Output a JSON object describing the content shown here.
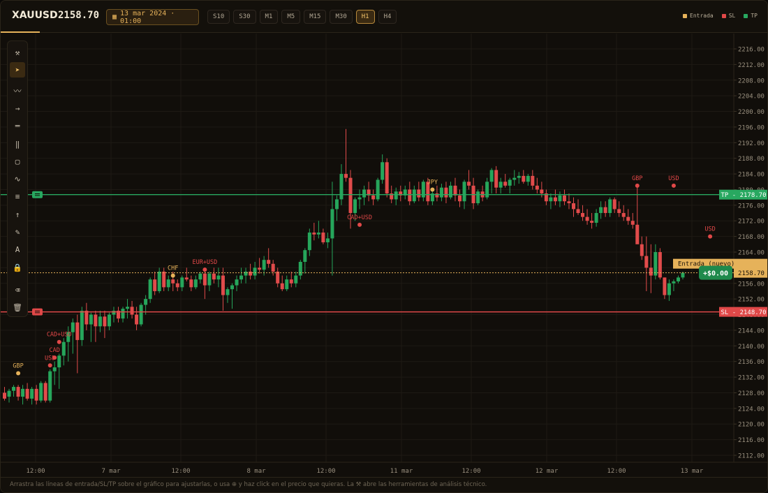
{
  "header": {
    "symbol": "XAUUSD",
    "price": "2158.70",
    "date": "13 mar 2024 · 01:00",
    "timeframes": [
      "S10",
      "S30",
      "M1",
      "M5",
      "M15",
      "M30",
      "H1",
      "H4"
    ],
    "active_timeframe": "H1",
    "legend": [
      {
        "label": "Entrada",
        "color": "#e6b25a"
      },
      {
        "label": "SL",
        "color": "#e04848"
      },
      {
        "label": "TP",
        "color": "#28a860"
      }
    ]
  },
  "toolbar": {
    "icons": [
      "crossed-tools-icon",
      "cursor-icon",
      "trend-line-icon",
      "ray-arrow-icon",
      "horizontal-lines-icon",
      "vertical-lines-icon",
      "rectangle-icon",
      "wave-icon",
      "fib-lines-icon",
      "up-arrow-icon",
      "pencil-icon",
      "text-icon",
      "magnet-lock-icon",
      "eraser-icon",
      "trash-icon"
    ],
    "glyphs": [
      "⚒",
      "➤",
      "〰",
      "→",
      "═",
      "‖",
      "▢",
      "∿",
      "≡",
      "↑",
      "✎",
      "A",
      "🔒",
      "⌫",
      "🗑"
    ],
    "active_index": 1
  },
  "chart_data": {
    "type": "candlestick",
    "y_axis_ticks": [
      "2216.00",
      "2212.00",
      "2208.00",
      "2204.00",
      "2200.00",
      "2196.00",
      "2192.00",
      "2188.00",
      "2184.00",
      "2180.00",
      "2176.00",
      "2172.00",
      "2168.00",
      "2164.00",
      "2160.00",
      "2156.00",
      "2152.00",
      "2148.00",
      "2144.00",
      "2140.00",
      "2136.00",
      "2132.00",
      "2128.00",
      "2124.00",
      "2120.00",
      "2116.00",
      "2112.00"
    ],
    "ylim": [
      2110,
      2218
    ],
    "x_axis_labels": [
      "12:00",
      "7 mar",
      "12:00",
      "8 mar",
      "12:00",
      "11 mar",
      "12:00",
      "12 mar",
      "12:00",
      "13 mar"
    ],
    "tp": {
      "label": "TP - 2178.70",
      "value": 2178.7,
      "color": "#28a860"
    },
    "sl": {
      "label": "SL - 2148.70",
      "value": 2148.7,
      "color": "#e04848"
    },
    "entry": {
      "label": "Entrada (nuevo)",
      "value": 2158.7,
      "color": "#e6b25a"
    },
    "entry_price_tag": "2158.70",
    "pnl_badge": "+$0.00",
    "events": [
      {
        "label": "GBP",
        "i": 3,
        "price": 2133,
        "color": "#e6b25a"
      },
      {
        "label": "USD",
        "i": 10,
        "price": 2135,
        "color": "#e04848"
      },
      {
        "label": "CAD",
        "i": 11,
        "price": 2137,
        "color": "#e04848"
      },
      {
        "label": "CAD+USD",
        "i": 12,
        "price": 2141,
        "color": "#e04848"
      },
      {
        "label": "CHF",
        "i": 37,
        "price": 2158,
        "color": "#e6b25a"
      },
      {
        "label": "EUR+USD",
        "i": 44,
        "price": 2159.5,
        "color": "#e04848"
      },
      {
        "label": "CAD+USD",
        "i": 78,
        "price": 2171,
        "color": "#e04848"
      },
      {
        "label": "JPY",
        "i": 94,
        "price": 2180,
        "color": "#e6b25a"
      },
      {
        "label": "GBP",
        "i": 139,
        "price": 2181,
        "color": "#e04848"
      },
      {
        "label": "USD",
        "i": 147,
        "price": 2181,
        "color": "#e04848"
      },
      {
        "label": "USD",
        "i": 155,
        "price": 2168,
        "color": "#e04848"
      }
    ],
    "candles": [
      [
        2128,
        2129.5,
        2126,
        2126.5
      ],
      [
        2127,
        2129,
        2125.5,
        2128.5
      ],
      [
        2128.5,
        2130,
        2127,
        2129.5
      ],
      [
        2129.5,
        2130,
        2126,
        2127
      ],
      [
        2127,
        2130,
        2125,
        2129
      ],
      [
        2129,
        2130.5,
        2126,
        2126.5
      ],
      [
        2126.5,
        2129.5,
        2125,
        2129
      ],
      [
        2129,
        2130,
        2125,
        2126
      ],
      [
        2126,
        2131,
        2125.5,
        2130.5
      ],
      [
        2130.5,
        2131,
        2125.5,
        2126
      ],
      [
        2126,
        2134,
        2125.5,
        2133.5
      ],
      [
        2133.5,
        2136,
        2130,
        2134.5
      ],
      [
        2134.5,
        2138,
        2129,
        2137.5
      ],
      [
        2137.5,
        2142,
        2135,
        2141
      ],
      [
        2141,
        2145,
        2136,
        2143.5
      ],
      [
        2143.5,
        2147,
        2138,
        2146
      ],
      [
        2146,
        2148,
        2133,
        2141.5
      ],
      [
        2141.5,
        2150,
        2140,
        2149
      ],
      [
        2149,
        2151,
        2144,
        2145.5
      ],
      [
        2145.5,
        2148.5,
        2141,
        2148
      ],
      [
        2148,
        2149,
        2141,
        2145
      ],
      [
        2145,
        2149,
        2143.5,
        2147.5
      ],
      [
        2147.5,
        2149,
        2142,
        2145
      ],
      [
        2145,
        2148.5,
        2144,
        2148
      ],
      [
        2148,
        2150,
        2146,
        2149
      ],
      [
        2149,
        2150,
        2146,
        2147
      ],
      [
        2147,
        2150,
        2146,
        2149.5
      ],
      [
        2149.5,
        2152,
        2147,
        2150
      ],
      [
        2150,
        2151.5,
        2147,
        2148
      ],
      [
        2148,
        2150,
        2144,
        2145.5
      ],
      [
        2145.5,
        2151,
        2145,
        2150.5
      ],
      [
        2150.5,
        2153,
        2148,
        2152
      ],
      [
        2152,
        2157.5,
        2151,
        2157
      ],
      [
        2157,
        2159,
        2153,
        2154
      ],
      [
        2154,
        2160,
        2153.5,
        2159
      ],
      [
        2159,
        2160,
        2154,
        2155
      ],
      [
        2155,
        2158,
        2154,
        2157
      ],
      [
        2157,
        2159,
        2154,
        2156
      ],
      [
        2156,
        2157,
        2154,
        2155
      ],
      [
        2155,
        2158,
        2154,
        2157.5
      ],
      [
        2157.5,
        2160,
        2156.5,
        2157
      ],
      [
        2157,
        2158,
        2154,
        2155
      ],
      [
        2155,
        2158,
        2154.5,
        2157
      ],
      [
        2157,
        2159,
        2156,
        2158.5
      ],
      [
        2158.5,
        2160,
        2152,
        2155.5
      ],
      [
        2155.5,
        2159,
        2154,
        2158.5
      ],
      [
        2158.5,
        2160,
        2156,
        2157
      ],
      [
        2157,
        2160,
        2155,
        2158
      ],
      [
        2158,
        2160,
        2149,
        2153
      ],
      [
        2153,
        2155,
        2151,
        2154.5
      ],
      [
        2154.5,
        2156,
        2149.5,
        2155.5
      ],
      [
        2155.5,
        2158,
        2154,
        2157
      ],
      [
        2157,
        2160,
        2156,
        2158
      ],
      [
        2158,
        2160,
        2156,
        2159
      ],
      [
        2159,
        2161,
        2157,
        2158
      ],
      [
        2158,
        2161.5,
        2157,
        2160
      ],
      [
        2160,
        2162.5,
        2158.5,
        2159.5
      ],
      [
        2159.5,
        2163,
        2158,
        2162
      ],
      [
        2162,
        2165,
        2160,
        2161
      ],
      [
        2161,
        2162,
        2158,
        2159
      ],
      [
        2159,
        2160,
        2155,
        2156
      ],
      [
        2156,
        2158,
        2154,
        2154.5
      ],
      [
        2154.5,
        2158,
        2154,
        2157
      ],
      [
        2157,
        2159,
        2155,
        2156
      ],
      [
        2156,
        2159,
        2155,
        2158
      ],
      [
        2158,
        2162,
        2157,
        2161.5
      ],
      [
        2161.5,
        2165,
        2158.5,
        2164.5
      ],
      [
        2164.5,
        2170,
        2163,
        2169
      ],
      [
        2169,
        2171.5,
        2167,
        2168.5
      ],
      [
        2168.5,
        2172,
        2167.5,
        2169
      ],
      [
        2169,
        2170,
        2166,
        2166.5
      ],
      [
        2166.5,
        2169,
        2165,
        2167.5
      ],
      [
        2167.5,
        2182,
        2158,
        2175
      ],
      [
        2175,
        2178.5,
        2172,
        2177.5
      ],
      [
        2177.5,
        2186.5,
        2176,
        2184
      ],
      [
        2184,
        2195.5,
        2182,
        2183
      ],
      [
        2183,
        2185,
        2170,
        2174
      ],
      [
        2174,
        2178,
        2172,
        2177.5
      ],
      [
        2177.5,
        2180,
        2175,
        2178
      ],
      [
        2178,
        2181,
        2176,
        2180
      ],
      [
        2180,
        2182,
        2177,
        2178.5
      ],
      [
        2178.5,
        2180,
        2176,
        2177.5
      ],
      [
        2177.5,
        2183,
        2177,
        2182.5
      ],
      [
        2182.5,
        2189,
        2181.5,
        2187
      ],
      [
        2187,
        2188,
        2178,
        2179
      ],
      [
        2179,
        2181,
        2176.5,
        2177.5
      ],
      [
        2177.5,
        2180.5,
        2176,
        2179.5
      ],
      [
        2179.5,
        2181,
        2177,
        2178.5
      ],
      [
        2178.5,
        2181,
        2177.5,
        2180
      ],
      [
        2180,
        2182,
        2176,
        2177
      ],
      [
        2177,
        2181,
        2176.5,
        2180
      ],
      [
        2180,
        2182,
        2177,
        2178
      ],
      [
        2178,
        2182.5,
        2177,
        2182
      ],
      [
        2182,
        2183,
        2176,
        2177
      ],
      [
        2177,
        2180,
        2176,
        2179
      ],
      [
        2179,
        2181,
        2177,
        2178
      ],
      [
        2178,
        2181.5,
        2177,
        2180.5
      ],
      [
        2180.5,
        2182,
        2176.5,
        2178
      ],
      [
        2178,
        2182,
        2177.5,
        2181
      ],
      [
        2181,
        2183,
        2177,
        2178.5
      ],
      [
        2178.5,
        2180,
        2175.5,
        2177
      ],
      [
        2177,
        2182.5,
        2175,
        2182
      ],
      [
        2182,
        2185,
        2180,
        2181
      ],
      [
        2181,
        2183,
        2175,
        2176.5
      ],
      [
        2176.5,
        2180,
        2176,
        2179.5
      ],
      [
        2179.5,
        2181,
        2177,
        2178
      ],
      [
        2178,
        2183,
        2177.5,
        2182
      ],
      [
        2182,
        2185.5,
        2179,
        2185
      ],
      [
        2185,
        2186,
        2179,
        2180.5
      ],
      [
        2180.5,
        2183,
        2179,
        2182
      ],
      [
        2182,
        2184,
        2180.5,
        2181
      ],
      [
        2181,
        2183,
        2179,
        2182.5
      ],
      [
        2182.5,
        2185,
        2181,
        2183
      ],
      [
        2183,
        2184.5,
        2181.5,
        2183.5
      ],
      [
        2183.5,
        2185,
        2181.5,
        2182
      ],
      [
        2182,
        2184,
        2181,
        2183.5
      ],
      [
        2183.5,
        2185,
        2180,
        2181
      ],
      [
        2181,
        2183,
        2179,
        2180
      ],
      [
        2180,
        2182,
        2178,
        2179
      ],
      [
        2179,
        2180,
        2176,
        2177
      ],
      [
        2177,
        2179,
        2175,
        2178
      ],
      [
        2178,
        2180,
        2176,
        2177
      ],
      [
        2177,
        2179.5,
        2175.5,
        2178.5
      ],
      [
        2178.5,
        2180,
        2176,
        2177
      ],
      [
        2177,
        2179,
        2175,
        2176.5
      ],
      [
        2176.5,
        2178,
        2173,
        2175
      ],
      [
        2175,
        2177.5,
        2173.5,
        2174
      ],
      [
        2174,
        2176,
        2172,
        2173
      ],
      [
        2173,
        2175,
        2171,
        2172
      ],
      [
        2172,
        2174,
        2170,
        2171.5
      ],
      [
        2171.5,
        2175,
        2170.5,
        2174
      ],
      [
        2174,
        2177,
        2172.5,
        2175.5
      ],
      [
        2175.5,
        2177,
        2173,
        2174
      ],
      [
        2174,
        2178,
        2173,
        2177.5
      ],
      [
        2177.5,
        2178,
        2174,
        2175
      ],
      [
        2175,
        2177,
        2173,
        2174
      ],
      [
        2174,
        2176,
        2172,
        2173
      ],
      [
        2173,
        2175,
        2171,
        2172
      ],
      [
        2172,
        2174,
        2170,
        2171
      ],
      [
        2171,
        2181,
        2169,
        2166
      ],
      [
        2166,
        2168,
        2162,
        2163
      ],
      [
        2163,
        2168,
        2154,
        2160
      ],
      [
        2160,
        2166,
        2153.5,
        2158
      ],
      [
        2158,
        2166,
        2157,
        2164
      ],
      [
        2164,
        2165,
        2157,
        2157.5
      ],
      [
        2157.5,
        2157.5,
        2152,
        2153
      ],
      [
        2153,
        2157,
        2151.5,
        2156
      ],
      [
        2156,
        2157,
        2154,
        2156.5
      ],
      [
        2156.5,
        2158,
        2156,
        2157.5
      ],
      [
        2157.5,
        2159,
        2157,
        2158.7
      ]
    ]
  },
  "footer": {
    "hint": "Arrastra las líneas de entrada/SL/TP sobre el gráfico para ajustarlas, o usa ⊕ y haz click en el precio que quieras. La ⚒ abre las herramientas de análisis técnico."
  }
}
